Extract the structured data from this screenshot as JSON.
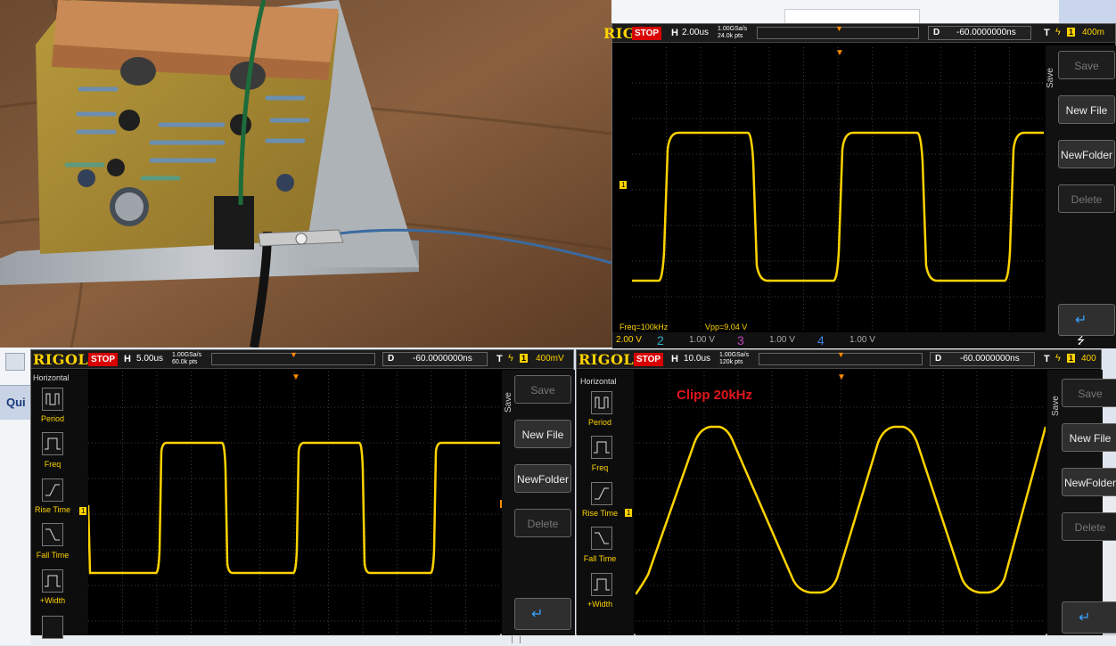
{
  "colors": {
    "trace": "#ffd300",
    "brand": "#ffd300",
    "stop": "#d80000",
    "note": "#e0161b"
  },
  "top_right": {
    "brand": "RIGOL",
    "status": "STOP",
    "h_label": "H",
    "time_div": "2.00us",
    "rate": "1.00GSa/s",
    "pts": "24.0k pts",
    "delay_label": "D",
    "delay": "-60.0000000ns",
    "trig_label": "T",
    "trig_ch": "1",
    "trig_level": "400m",
    "measure_freq": "Freq=100kHz",
    "measure_vpp": "Vpp=9.04 V",
    "ch1_scale": "2.00 V",
    "ch2": "2",
    "ch2_scale": "1.00 V",
    "ch3": "3",
    "ch3_scale": "1.00 V",
    "ch4": "4",
    "ch4_scale": "1.00 V",
    "save_side_label": "Save",
    "buttons": [
      "Save",
      "New File",
      "NewFolder",
      "Delete"
    ]
  },
  "bottom_left": {
    "brand": "RIGOL",
    "status": "STOP",
    "h_label": "H",
    "time_div": "5.00us",
    "rate": "1.00GSa/s",
    "pts": "60.0k pts",
    "delay_label": "D",
    "delay": "-60.0000000ns",
    "trig_label": "T",
    "trig_ch": "1",
    "trig_level": "400mV",
    "menu_title": "Horizontal",
    "menu": [
      "Period",
      "Freq",
      "Rise Time",
      "Fall Time",
      "+Width"
    ],
    "save_side_label": "Save",
    "buttons": [
      "Save",
      "New File",
      "NewFolder",
      "Delete"
    ]
  },
  "bottom_right": {
    "brand": "RIGOL",
    "status": "STOP",
    "h_label": "H",
    "time_div": "10.0us",
    "rate": "1.00GSa/s",
    "pts": "120k pts",
    "delay_label": "D",
    "delay": "-60.0000000ns",
    "trig_label": "T",
    "trig_ch": "1",
    "trig_level": "400",
    "menu_title": "Horizontal",
    "menu": [
      "Period",
      "Freq",
      "Rise Time",
      "Fall Time",
      "+Width"
    ],
    "annotation": "Clipp 20kHz",
    "save_side_label": "Save",
    "buttons": [
      "Save",
      "New File",
      "NewFolder",
      "Delete"
    ]
  },
  "background_window": {
    "label": "Qui"
  }
}
